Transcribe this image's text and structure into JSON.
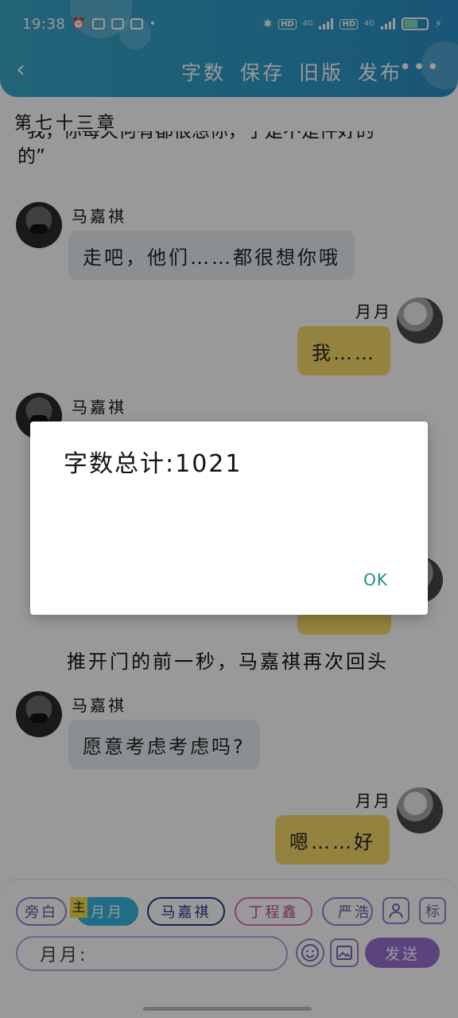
{
  "status_bar": {
    "time": "19:38",
    "hd1": "HD",
    "net1": "4G",
    "hd2": "HD",
    "net2": "4G",
    "battery_percent": 60,
    "battery_text": "60"
  },
  "header": {
    "back_icon": "chevron-left-icon",
    "actions": [
      "字数",
      "保存",
      "旧版",
      "发布"
    ],
    "more_label": "•••"
  },
  "chapter_title": "第七十三章",
  "cut_text": {
    "line1": "“我，你每天何有都很想你，于是不是件好的",
    "line2": "的”"
  },
  "messages": [
    {
      "speaker": "马嘉祺",
      "text": "走吧，他们……都很想你哦",
      "side": "left"
    },
    {
      "speaker": "月月",
      "text": "我……",
      "side": "right"
    },
    {
      "speaker": "马嘉祺",
      "text": "",
      "side": "left"
    },
    {
      "speaker": "",
      "text": "",
      "side": "right"
    }
  ],
  "narration": "推开门的前一秒，马嘉祺再次回头",
  "messages2": [
    {
      "speaker": "马嘉祺",
      "text": "愿意考虑考虑吗?",
      "side": "left"
    },
    {
      "speaker": "月月",
      "text": "嗯……好",
      "side": "right"
    }
  ],
  "toolbar": {
    "chips": [
      "旁白",
      "月月",
      "马嘉祺",
      "丁程鑫",
      "严浩"
    ],
    "main_tag": "主",
    "character_icon": "person-icon",
    "tag_label": "标",
    "input_value": "月月:",
    "emoji_icon": "smile-icon",
    "image_icon": "image-icon",
    "send_label": "发送"
  },
  "dialog": {
    "message": "字数总计:1021",
    "ok_label": "OK"
  },
  "colors": {
    "header_blue": "#2f9cc8",
    "bubble_yellow": "#f7d96a",
    "bubble_gray": "#e9eef2",
    "send_purple": "#9c6fd6",
    "ok_teal": "#1a8f8a"
  }
}
